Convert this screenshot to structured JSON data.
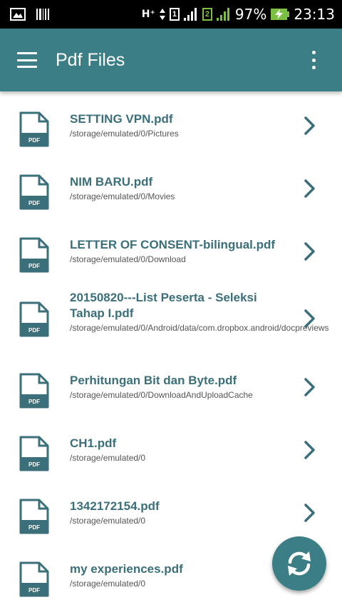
{
  "status_bar": {
    "network": "H⁺",
    "sim1": "1",
    "sim2": "2",
    "battery": "97%",
    "time": "23:13"
  },
  "app_bar": {
    "title": "Pdf Files"
  },
  "file_type_label": "PDF",
  "files": [
    {
      "name": "SETTING VPN.pdf",
      "path": "/storage/emulated/0/Pictures"
    },
    {
      "name": "NIM BARU.pdf",
      "path": "/storage/emulated/0/Movies"
    },
    {
      "name": "LETTER OF CONSENT-bilingual.pdf",
      "path": "/storage/emulated/0/Download"
    },
    {
      "name": "20150820---List Peserta - Seleksi Tahap I.pdf",
      "path": "/storage/emulated/0/Android/data/com.dropbox.android/docpreviews"
    },
    {
      "name": "Perhitungan Bit dan Byte.pdf",
      "path": "/storage/emulated/0/DownloadAndUploadCache"
    },
    {
      "name": "CH1.pdf",
      "path": "/storage/emulated/0"
    },
    {
      "name": "1342172154.pdf",
      "path": "/storage/emulated/0"
    },
    {
      "name": "my experiences.pdf",
      "path": "/storage/emulated/0"
    }
  ],
  "colors": {
    "primary": "#3b7e86",
    "file_name": "#3b6f7a",
    "signal_green": "#7bc043"
  },
  "icons": [
    "gallery-icon",
    "barcode-icon",
    "menu-icon",
    "overflow-icon",
    "pdf-file-icon",
    "chevron-right-icon",
    "refresh-icon"
  ]
}
